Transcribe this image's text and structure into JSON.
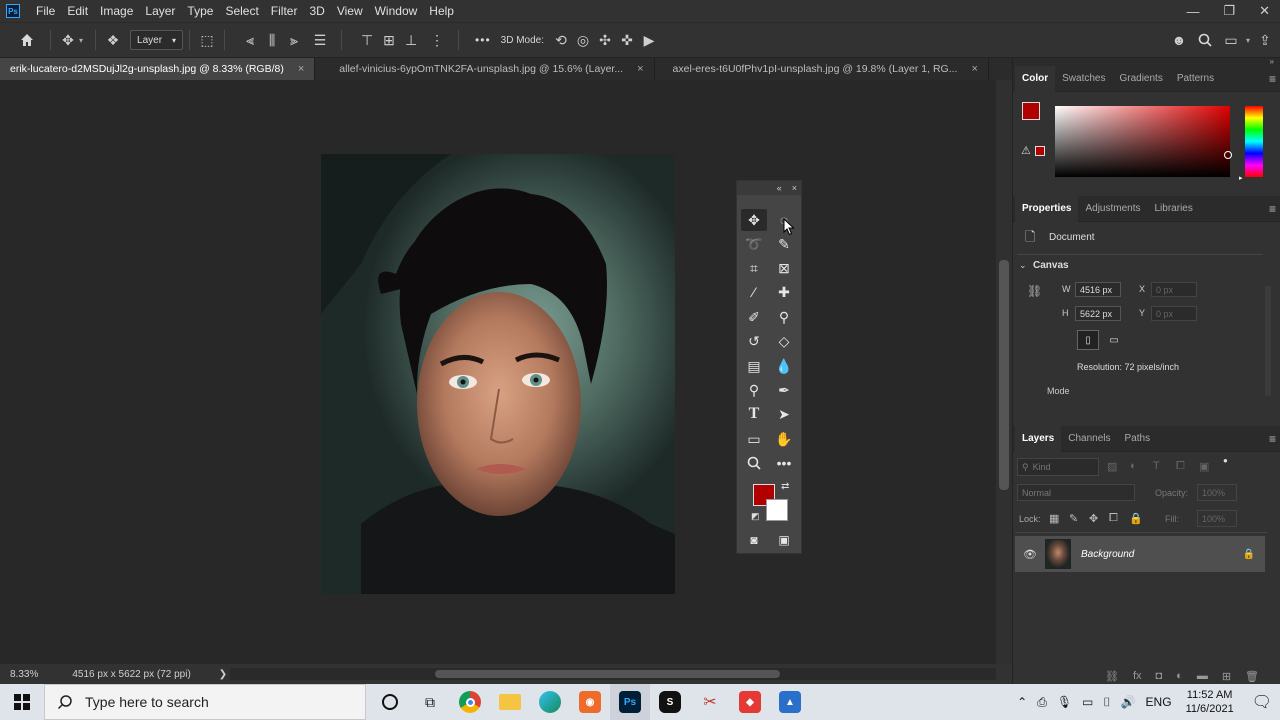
{
  "app": {
    "logo_text": "Ps"
  },
  "menubar": {
    "items": [
      "File",
      "Edit",
      "Image",
      "Layer",
      "Type",
      "Select",
      "Filter",
      "3D",
      "View",
      "Window",
      "Help"
    ]
  },
  "window_controls": {
    "minimize": "—",
    "restore": "❐",
    "close": "✕"
  },
  "options_bar": {
    "layer_select": "Layer",
    "more": "•••",
    "mode_label": "3D Mode:"
  },
  "tabs": [
    {
      "label": "erik-lucatero-d2MSDujJl2g-unsplash.jpg @ 8.33% (RGB/8)",
      "close": "×"
    },
    {
      "label": "allef-vinicius-6ypOmTNK2FA-unsplash.jpg @ 15.6% (Layer...",
      "close": "×"
    },
    {
      "label": "axel-eres-t6U0fPhv1pI-unsplash.jpg @ 19.8% (Layer 1, RG...",
      "close": "×"
    }
  ],
  "status": {
    "zoom": "8.33%",
    "doc_info": "4516 px x 5622 px (72 ppi)",
    "arrow": "❯",
    "left_arrow": "‹"
  },
  "toolbox": {
    "collapse": "«",
    "close": "×"
  },
  "colors": {
    "foreground": "#b00000",
    "background": "#ffffff",
    "accent": "#31a8ff"
  },
  "color_panel": {
    "tabs": [
      "Color",
      "Swatches",
      "Gradients",
      "Patterns"
    ]
  },
  "properties_panel": {
    "tabs": [
      "Properties",
      "Adjustments",
      "Libraries"
    ],
    "doc_label": "Document",
    "section": "Canvas",
    "w_label": "W",
    "w_value": "4516 px",
    "h_label": "H",
    "h_value": "5622 px",
    "x_label": "X",
    "x_value": "0 px",
    "y_label": "Y",
    "y_value": "0 px",
    "resolution": "Resolution: 72 pixels/inch",
    "mode_label": "Mode"
  },
  "layers_panel": {
    "tabs": [
      "Layers",
      "Channels",
      "Paths"
    ],
    "kind_placeholder": "Kind",
    "blend_mode": "Normal",
    "opacity_label": "Opacity:",
    "opacity_value": "100%",
    "lock_label": "Lock:",
    "fill_label": "Fill:",
    "fill_value": "100%",
    "layers": [
      {
        "name": "Background"
      }
    ]
  },
  "taskbar": {
    "search_placeholder": "Type here to search",
    "lang": "ENG",
    "time": "11:52 AM",
    "date": "11/6/2021"
  }
}
